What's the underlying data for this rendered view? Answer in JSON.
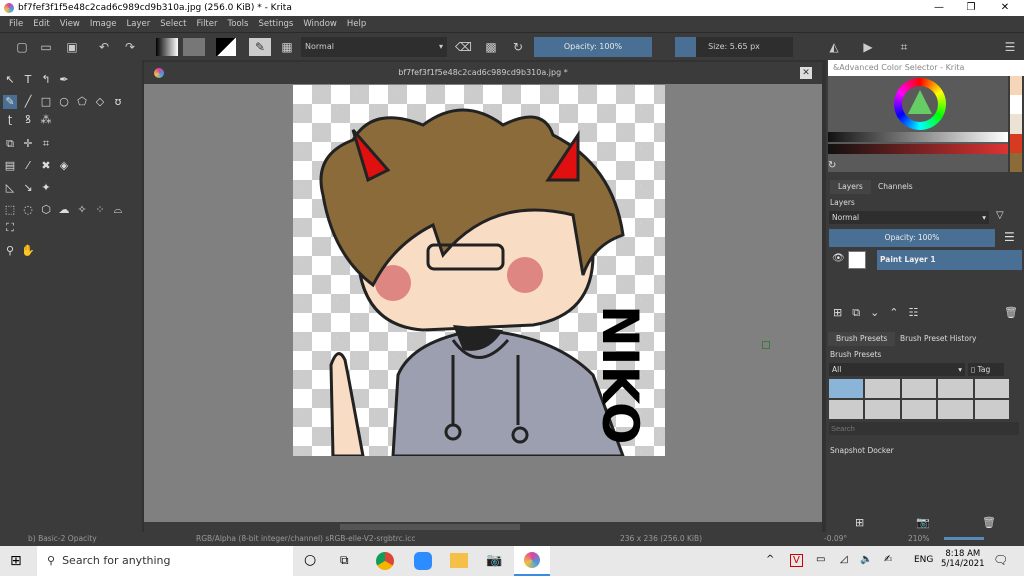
{
  "window": {
    "title": "bf7fef3f1f5e48c2cad6c989cd9b310a.jpg (256.0 KiB)  * - Krita",
    "minimize": "—",
    "maximize": "❐",
    "close": "✕"
  },
  "menu": [
    "File",
    "Edit",
    "View",
    "Image",
    "Layer",
    "Select",
    "Filter",
    "Tools",
    "Settings",
    "Window",
    "Help"
  ],
  "toolbar": {
    "blend_mode": "Normal",
    "opacity": "Opacity: 100%",
    "size": "Size: 5.65 px"
  },
  "document_tab": {
    "title": "bf7fef3f1f5e48c2cad6c989cd9b310a.jpg *"
  },
  "color_selector": {
    "title": "&Advanced Color Selector - Krita",
    "swatches": [
      "#f5d6b8",
      "#ffffff",
      "#ece2d3",
      "#d83a20",
      "#8b6b3a"
    ]
  },
  "layers": {
    "tabs": [
      "Layers",
      "Channels"
    ],
    "title": "Layers",
    "blend_mode": "Normal",
    "opacity": "Opacity:  100%",
    "layer_name": "Paint Layer 1"
  },
  "brush_presets": {
    "tabs": [
      "Brush Presets",
      "Brush Preset History"
    ],
    "title": "Brush Presets",
    "filter": "All",
    "tag": "Tag",
    "search_placeholder": "Search"
  },
  "snapshot": {
    "title": "Snapshot Docker"
  },
  "artwork": {
    "text": "NIKO"
  },
  "status": {
    "brush": "b) Basic-2 Opacity",
    "color_space": "RGB/Alpha (8-bit integer/channel)  sRGB-elle-V2-srgbtrc.icc",
    "dimensions": "236 x 236 (256.0 KiB)",
    "rotation": "-0.09°",
    "zoom": "210%"
  },
  "taskbar": {
    "search_placeholder": "Search for anything",
    "language": "ENG",
    "time": "8:18 AM",
    "date": "5/14/2021"
  }
}
